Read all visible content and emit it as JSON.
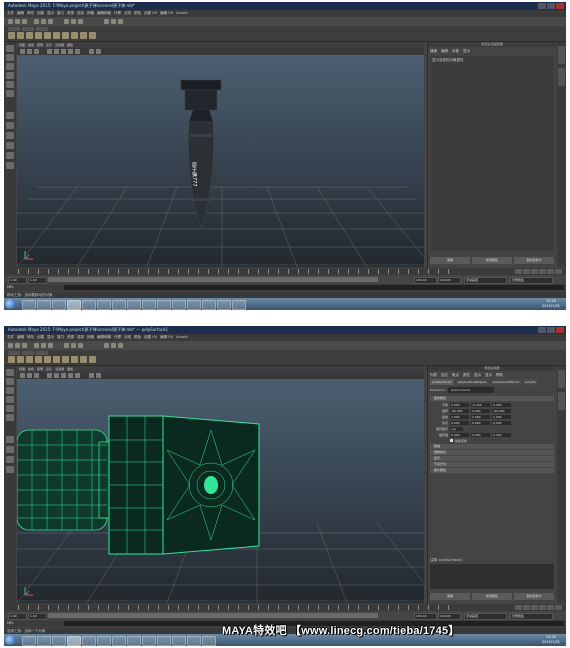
{
  "shot1": {
    "window_title": "Autodesk Maya 2015: F:\\Maya project\\原子弹\\scenes\\原子弹.mb*",
    "menu": [
      "文件",
      "编辑",
      "修改",
      "创建",
      "显示",
      "窗口",
      "资源",
      "选择",
      "网格",
      "编辑网格",
      "代理",
      "法线",
      "颜色",
      "创建 UV",
      "编辑 UV",
      "Arnold"
    ],
    "viewport_menu": [
      "视图",
      "着色",
      "照明",
      "显示",
      "渲染器",
      "面板"
    ],
    "model_label": "原子弹777",
    "panel_title": "通道盒/层编辑器",
    "panel_tabs": [
      "通道",
      "编辑",
      "对象",
      "显示"
    ],
    "panel_text": "显示选择的对象属性",
    "panel_buttons": [
      "选择",
      "加载属性",
      "复制选项卡"
    ],
    "range": {
      "start": "1.00",
      "start2": "1.00",
      "end": "120.00",
      "end2": "200.00",
      "current": "120.00",
      "anim_layer": "无动画层",
      "char_set": "无角色集"
    },
    "cmd_label": "MEL",
    "help_text": "移动工具：选择要移动的对象",
    "clock": {
      "time": "23:29",
      "date": "2015/1/31"
    }
  },
  "shot2": {
    "window_title": "Autodesk Maya 2015: F:\\Maya project\\原子弹\\scenes\\原子弹.mb* --- polySurface1",
    "menu": [
      "文件",
      "编辑",
      "修改",
      "创建",
      "显示",
      "窗口",
      "资源",
      "选择",
      "网格",
      "编辑网格",
      "代理",
      "法线",
      "颜色",
      "创建 UV",
      "编辑 UV",
      "Arnold"
    ],
    "viewport_menu": [
      "视图",
      "着色",
      "照明",
      "显示",
      "渲染器",
      "面板"
    ],
    "panel_title": "属性编辑器",
    "panel_tabs": [
      "列表",
      "选定",
      "焦点",
      "属性",
      "显示",
      "显示",
      "帮助"
    ],
    "node_tabs": [
      "polySurface1",
      "polySurfaceShape1",
      "polySmoothFace1",
      "polyTw"
    ],
    "transform_label": "transform:",
    "transform_value": "polySurface1",
    "section_open": "变换属性",
    "attrs": [
      {
        "label": "平移",
        "x": "0.000",
        "y": "-6.342",
        "z": "0.000"
      },
      {
        "label": "旋转",
        "x": "-90.000",
        "y": "0.000",
        "z": "-90.000"
      },
      {
        "label": "缩放",
        "x": "1.000",
        "y": "1.000",
        "z": "1.000"
      },
      {
        "label": "剪切",
        "x": "0.000",
        "y": "0.000",
        "z": "0.000"
      },
      {
        "label": "旋转顺序",
        "x": "xyz",
        "y": "",
        "z": ""
      },
      {
        "label": "旋转轴",
        "x": "0.000",
        "y": "0.000",
        "z": "0.000"
      }
    ],
    "inherit_label": "继承变换",
    "sections_closed": [
      "枢轴",
      "限制信息",
      "显示",
      "节点行为",
      "额外属性"
    ],
    "notes_label": "注释: polySurface1",
    "panel_buttons": [
      "选择",
      "加载属性",
      "复制选项卡"
    ],
    "range": {
      "start": "1.00",
      "start2": "1.00",
      "end": "120.00",
      "end2": "200.00",
      "current": "120.00",
      "anim_layer": "无动画层",
      "char_set": "无角色集"
    },
    "cmd_label": "MEL",
    "help_text": "选择工具：选择一个对象",
    "clock": {
      "time": "23:34",
      "date": "2015/1/31"
    }
  },
  "watermark": "MAYA特效吧 【www.linecg.com/tieba/1745】",
  "colors": {
    "wire": "#2ee89a",
    "viewport_top": "#4e6276",
    "viewport_bottom": "#22282e",
    "titlebar": "#1a2f4d"
  }
}
